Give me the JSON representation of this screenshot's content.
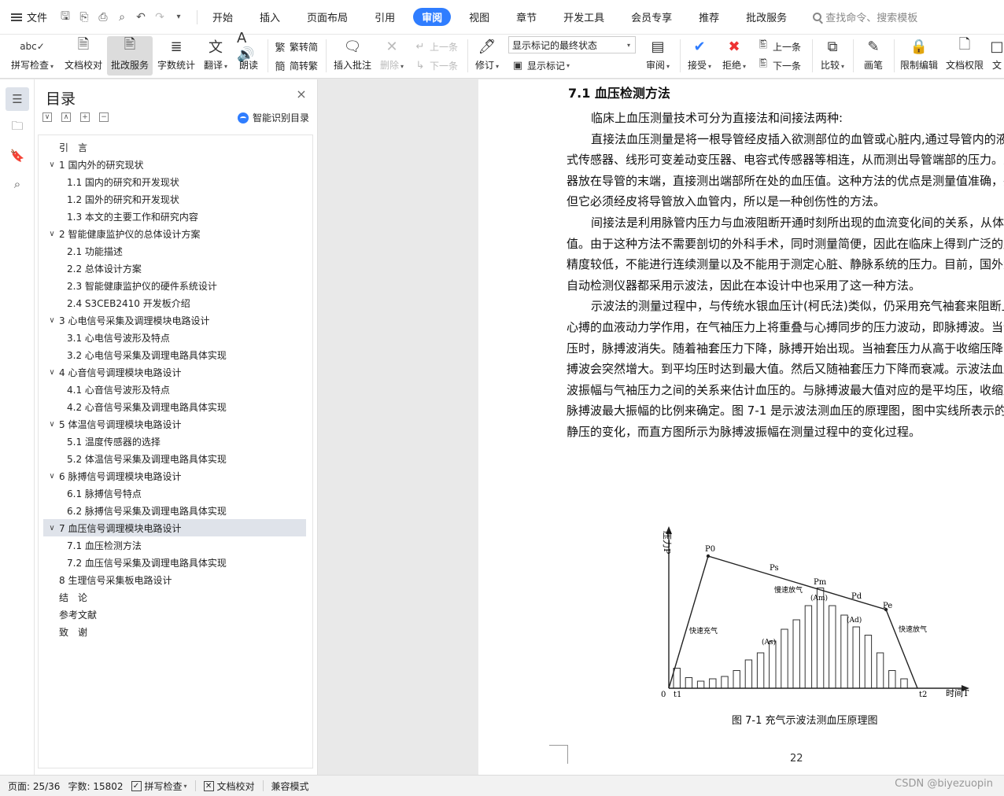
{
  "menubar": {
    "file_label": "文件",
    "tabs": [
      "开始",
      "插入",
      "页面布局",
      "引用",
      "审阅",
      "视图",
      "章节",
      "开发工具",
      "会员专享",
      "推荐",
      "批改服务"
    ],
    "active_tab": "审阅",
    "search_placeholder": "查找命令、搜索模板"
  },
  "ribbon": {
    "spell_check": "拼写检查",
    "doc_proof": "文档校对",
    "review_service": "批改服务",
    "word_count": "字数统计",
    "translate": "翻译",
    "read_aloud": "朗读",
    "trad_convert": "繁转简",
    "simp_convert": "简转繁",
    "insert_comment": "插入批注",
    "delete": "删除",
    "prev_comment": "上一条",
    "next_comment": "下一条",
    "markup_mode": "显示标记的最终状态",
    "show_markup": "显示标记",
    "revise": "修订",
    "review": "审阅",
    "accept": "接受",
    "reject": "拒绝",
    "prev_change": "上一条",
    "next_change": "下一条",
    "compare": "比较",
    "pen": "画笔",
    "restrict_edit": "限制编辑",
    "doc_permission": "文档权限",
    "more": "文"
  },
  "toc": {
    "title": "目录",
    "smart_label": "智能识别目录",
    "items": [
      {
        "text": "引　言",
        "level": 1,
        "chevron": false
      },
      {
        "text": "1  国内外的研究现状",
        "level": 1,
        "chevron": true
      },
      {
        "text": "1.1 国内的研究和开发现状",
        "level": 2,
        "chevron": false
      },
      {
        "text": "1.2 国外的研究和开发现状",
        "level": 2,
        "chevron": false
      },
      {
        "text": "1.3 本文的主要工作和研究内容",
        "level": 2,
        "chevron": false
      },
      {
        "text": "2 智能健康监护仪的总体设计方案",
        "level": 1,
        "chevron": true
      },
      {
        "text": "2.1 功能描述",
        "level": 2,
        "chevron": false
      },
      {
        "text": "2.2 总体设计方案",
        "level": 2,
        "chevron": false
      },
      {
        "text": "2.3 智能健康监护仪的硬件系统设计",
        "level": 2,
        "chevron": false
      },
      {
        "text": "2.4 S3CEB2410 开发板介绍",
        "level": 2,
        "chevron": false
      },
      {
        "text": "3 心电信号采集及调理模块电路设计",
        "level": 1,
        "chevron": true
      },
      {
        "text": "3.1 心电信号波形及特点",
        "level": 2,
        "chevron": false
      },
      {
        "text": "3.2 心电信号采集及调理电路具体实现",
        "level": 2,
        "chevron": false
      },
      {
        "text": "4 心音信号调理模块电路设计",
        "level": 1,
        "chevron": true
      },
      {
        "text": "4.1 心音信号波形及特点",
        "level": 2,
        "chevron": false
      },
      {
        "text": "4.2 心音信号采集及调理电路具体实现",
        "level": 2,
        "chevron": false
      },
      {
        "text": "5 体温信号调理模块电路设计",
        "level": 1,
        "chevron": true
      },
      {
        "text": "5.1 温度传感器的选择",
        "level": 2,
        "chevron": false
      },
      {
        "text": "5.2 体温信号采集及调理电路具体实现",
        "level": 2,
        "chevron": false
      },
      {
        "text": "6 脉搏信号调理模块电路设计",
        "level": 1,
        "chevron": true
      },
      {
        "text": "6.1 脉搏信号特点",
        "level": 2,
        "chevron": false
      },
      {
        "text": "6.2 脉搏信号采集及调理电路具体实现",
        "level": 2,
        "chevron": false
      },
      {
        "text": "7 血压信号调理模块电路设计",
        "level": 1,
        "chevron": true,
        "selected": true
      },
      {
        "text": "7.1 血压检测方法",
        "level": 2,
        "chevron": false
      },
      {
        "text": "7.2 血压信号采集及调理电路具体实现",
        "level": 2,
        "chevron": false
      },
      {
        "text": "8 生理信号采集板电路设计",
        "level": 1,
        "chevron": false
      },
      {
        "text": "结　论",
        "level": 1,
        "chevron": false
      },
      {
        "text": "参考文献",
        "level": 1,
        "chevron": false
      },
      {
        "text": "致　谢",
        "level": 1,
        "chevron": false
      }
    ]
  },
  "document": {
    "section_title": "7.1 血压检测方法",
    "paragraphs": [
      "临床上血压测量技术可分为直接法和间接法两种:",
      "直接法血压测量是将一根导管经皮插入欲测部位的血管或心脏内,通过导管内的液柱同放在体外的应变式传感器、线形可变差动变压器、电容式传感器等相连，从而测出导管端部的压力。另一种形式是把传感器放在导管的末端，直接测出端部所在处的血压值。这种方法的优点是测量值准确，并能进行连续测量。但它必须经皮将导管放入血管内，所以是一种创伤性的方法。",
      "间接法是利用脉管内压力与血液阻断开通时刻所出现的血流变化间的关系，从体表测出相应的压力值。由于这种方法不需要剖切的外科手术，同时测量简便，因此在临床上得到广泛的应用。其缺点是测量精度较低，不能进行连续测量以及不能用于测定心脏、静脉系统的压力。目前，国外大多数无损自动血压自动检测仪器都采用示波法，因此在本设计中也采用了这一种方法。",
      "示波法的测量过程中，与传统水银血压计(柯氏法)类似，仍采用充气袖套来阻断上臂动脉血流。由于心搏的血液动力学作用，在气袖压力上将重叠与心搏同步的压力波动，即脉搏波。当气袖压力远高于收缩压时，脉搏波消失。随着袖套压力下降，脉搏开始出现。当袖套压力从高于收缩压降到收缩压以下时，脉搏波会突然增大。到平均压时达到最大值。然后又随袖套压力下降而衰减。示波法血压测量就是根据脉搏波振幅与气袖压力之间的关系来估计血压的。与脉搏波最大值对应的是平均压，收缩压和舒张压分别对应脉搏波最大振幅的比例来确定。图 7-1 是示波法测血压的原理图，图中实线所表示的是在测量过程中袖带静压的变化，而直方图所示为脉搏波振幅在测量过程中的变化过程。"
    ],
    "figure": {
      "y_axis_label": "压力P",
      "x_axis_label": "时间T",
      "origin_label": "0",
      "t1_label": "t1",
      "t2_label": "t2",
      "p0_label": "P0",
      "ps_label": "Ps",
      "pm_label": "Pm",
      "pd_label": "Pd",
      "pe_label": "Pe",
      "as_label": "(As)",
      "am_label": "(Am)",
      "ad_label": "(Ad)",
      "fast_inflate": "快速充气",
      "slow_deflate": "慢速放气",
      "fast_deflate": "快速放气",
      "bar_heights": [
        0.17,
        0.09,
        0.06,
        0.08,
        0.1,
        0.15,
        0.24,
        0.3,
        0.4,
        0.5,
        0.58,
        0.7,
        0.85,
        0.7,
        0.62,
        0.52,
        0.45,
        0.3,
        0.15,
        0.08
      ]
    },
    "caption": "图 7-1 充气示波法测血压原理图",
    "page_number": "22"
  },
  "statusbar": {
    "page": "页面: 25/36",
    "word_count": "字数: 15802",
    "spell_check": "拼写检查",
    "doc_proof": "文档校对",
    "compat_mode": "兼容模式",
    "watermark": "CSDN @biyezuopin"
  }
}
